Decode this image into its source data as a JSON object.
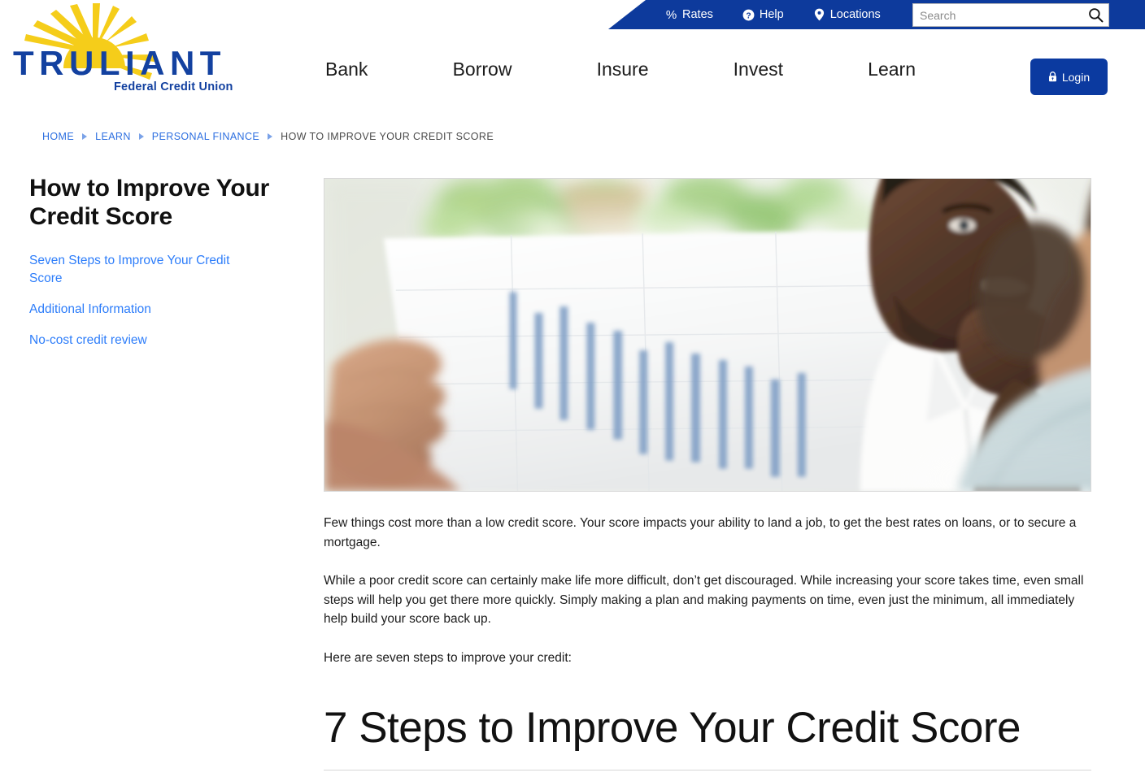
{
  "brand": {
    "name": "TRULIANT",
    "tagline": "Federal Credit Union",
    "logo_icon": "sunrise-logo-icon",
    "colors": {
      "navy": "#0d3a9c",
      "button_blue": "#0b3aa0",
      "sun_yellow": "#f5cd1a",
      "link_blue": "#2d7dfa",
      "crumb_blue": "#2d6fe0"
    }
  },
  "utility_bar": {
    "links": [
      {
        "label": "Rates",
        "icon": "percent-icon"
      },
      {
        "label": "Help",
        "icon": "question-circle-icon"
      },
      {
        "label": "Locations",
        "icon": "map-pin-icon"
      }
    ],
    "search": {
      "placeholder": "Search",
      "value": "",
      "icon": "search-icon"
    }
  },
  "main_nav": {
    "items": [
      {
        "label": "Bank"
      },
      {
        "label": "Borrow"
      },
      {
        "label": "Insure"
      },
      {
        "label": "Invest"
      },
      {
        "label": "Learn"
      }
    ],
    "login": {
      "label": "Login",
      "icon": "lock-icon"
    }
  },
  "breadcrumb": {
    "items": [
      {
        "label": "HOME",
        "current": false
      },
      {
        "label": "LEARN",
        "current": false
      },
      {
        "label": "PERSONAL FINANCE",
        "current": false
      },
      {
        "label": "HOW TO IMPROVE YOUR CREDIT SCORE",
        "current": true
      }
    ]
  },
  "sidebar": {
    "title": "How to Improve Your Credit Score",
    "links": [
      {
        "label": "Seven Steps to Improve Your Credit Score"
      },
      {
        "label": "Additional Information"
      },
      {
        "label": "No-cost credit review"
      }
    ]
  },
  "main": {
    "hero_image": {
      "alt": "Two men reviewing a printed financial chart report",
      "name": "credit-score-consultation-photo"
    },
    "paragraphs": [
      "Few things cost more than a low credit score. Your score impacts your ability to land a job, to get the best rates on loans, or to secure a mortgage.",
      "While a poor credit score can certainly make life more difficult, don’t get discouraged. While increasing your score takes time, even small steps will help you get there more quickly. Simply making a plan and making payments on time, even just the minimum, all immediately help build your score back up.",
      "Here are seven steps to improve your credit:"
    ],
    "section_heading": "7 Steps to Improve Your Credit Score"
  }
}
